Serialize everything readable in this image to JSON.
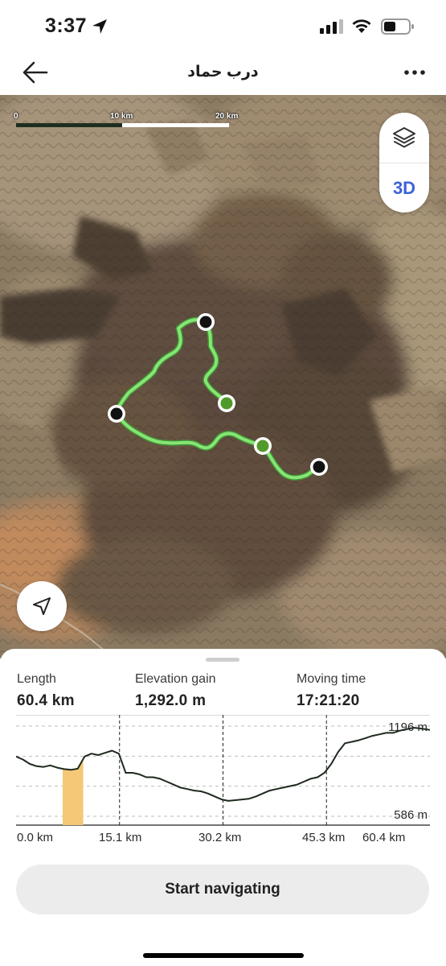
{
  "status_bar": {
    "time": "3:37",
    "icons": [
      "location-arrow-icon",
      "cellular-signal-icon",
      "wifi-icon",
      "battery-icon"
    ]
  },
  "header": {
    "title": "درب حماد",
    "back_icon": "arrow-left-icon",
    "more_icon": "ellipsis-icon"
  },
  "map": {
    "scale": {
      "labels": [
        "0",
        "10 km",
        "20 km"
      ]
    },
    "controls": {
      "layers_icon": "layers-icon",
      "mode_3d_label": "3D"
    },
    "locate_icon": "navigation-arrow-icon",
    "colors": {
      "route": "#7ee06e",
      "route_outline": "#55c24a",
      "waypoint_black": "#111111",
      "waypoint_green": "#4f9a2a"
    }
  },
  "stats": [
    {
      "label": "Length",
      "value": "60.4 km"
    },
    {
      "label": "Elevation gain",
      "value": "1,292.0 m"
    },
    {
      "label": "Moving time",
      "value": "17:21:20"
    }
  ],
  "elevation_chart": {
    "max_label": "1196 m",
    "min_label": "586 m",
    "x_labels": [
      "0.0 km",
      "15.1 km",
      "30.2 km",
      "45.3 km",
      "60.4 km"
    ],
    "highlight_color": "#f5c877",
    "chart_data": {
      "type": "area",
      "x": [
        0,
        1,
        2,
        3,
        4,
        5,
        6,
        7,
        8,
        9,
        10,
        11,
        12,
        13,
        14,
        15,
        16,
        17,
        18,
        19,
        20,
        21,
        22,
        23,
        24,
        25,
        26,
        27,
        28,
        29,
        30,
        31,
        32,
        33,
        34,
        35,
        36,
        37,
        38,
        39,
        40,
        41,
        42,
        43,
        44,
        45,
        46,
        47,
        48,
        49,
        50,
        51,
        52,
        53,
        54,
        55,
        56,
        57,
        58,
        59,
        60.4
      ],
      "y": [
        990,
        970,
        940,
        925,
        920,
        930,
        915,
        905,
        900,
        908,
        990,
        1010,
        1000,
        1015,
        1030,
        1010,
        880,
        880,
        870,
        850,
        850,
        840,
        820,
        800,
        780,
        770,
        760,
        755,
        740,
        720,
        700,
        690,
        695,
        700,
        705,
        720,
        740,
        760,
        770,
        780,
        790,
        800,
        820,
        840,
        850,
        880,
        940,
        1020,
        1080,
        1090,
        1100,
        1115,
        1130,
        1140,
        1150,
        1150,
        1165,
        1175,
        1185,
        1180,
        1170
      ],
      "ylim": [
        586,
        1196
      ],
      "xlim": [
        0,
        60.4
      ],
      "highlight_range": [
        6.8,
        9.8
      ],
      "xticks": [
        0,
        15.1,
        30.2,
        45.3,
        60.4
      ]
    }
  },
  "actions": {
    "start_label": "Start navigating"
  }
}
